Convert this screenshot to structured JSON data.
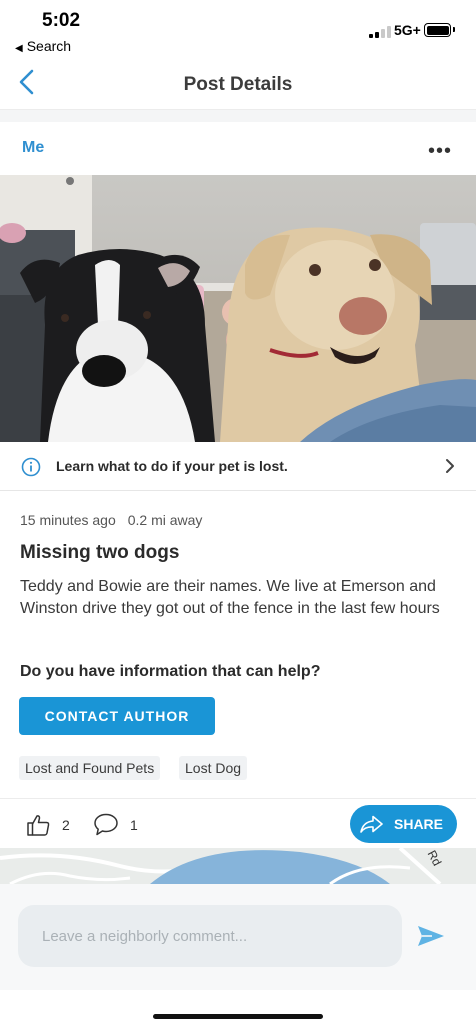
{
  "status_bar": {
    "time": "5:02",
    "back_app": "Search",
    "network": "5G+",
    "signal_bars": 4,
    "signal_active": 2
  },
  "nav": {
    "title": "Post Details",
    "back_icon": "chevron-left-icon"
  },
  "post": {
    "author": "Me",
    "more_icon": "more-horizontal-icon",
    "image_description": "",
    "info_banner": "Learn what to do if your pet is lost.",
    "time_ago": "15 minutes ago",
    "distance": "0.2 mi away",
    "title": "Missing two dogs",
    "body": "Teddy and Bowie are their names. We live at Emerson and Winston drive they got out of the fence in the last few hours",
    "question": "Do you have information that can help?",
    "contact_button": "CONTACT AUTHOR",
    "tags": [
      "Lost and Found Pets",
      "Lost Dog"
    ]
  },
  "actions": {
    "like_count": "2",
    "comment_count": "1",
    "share_label": "SHARE"
  },
  "map": {
    "road_label": "Rd"
  },
  "composer": {
    "placeholder": "Leave a neighborly comment...",
    "value": ""
  },
  "colors": {
    "accent": "#1a95d6",
    "author": "#2f8fd0",
    "text": "#2b2b2b"
  }
}
